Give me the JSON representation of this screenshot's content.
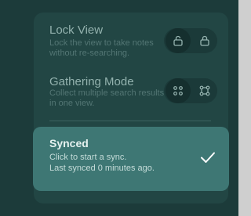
{
  "lock_view": {
    "title": "Lock View",
    "description": "Lock the view to take notes without re-searching.",
    "options": [
      {
        "icon": "unlock-icon",
        "active": true
      },
      {
        "icon": "lock-icon",
        "active": false
      }
    ]
  },
  "gathering_mode": {
    "title": "Gathering Mode",
    "description": "Collect multiple search results in one view.",
    "options": [
      {
        "icon": "grid-dots-icon",
        "active": true
      },
      {
        "icon": "nodes-icon",
        "active": false
      }
    ]
  },
  "sync": {
    "title": "Synced",
    "description": "Click to start a sync.\nLast synced 0 minutes ago.",
    "status_icon": "checkmark-icon"
  },
  "colors": {
    "background": "#1c3b3a",
    "panel": "#224644",
    "synced_card": "#3e7774",
    "muted_text": "#537674",
    "title_text": "#93b2ae"
  }
}
